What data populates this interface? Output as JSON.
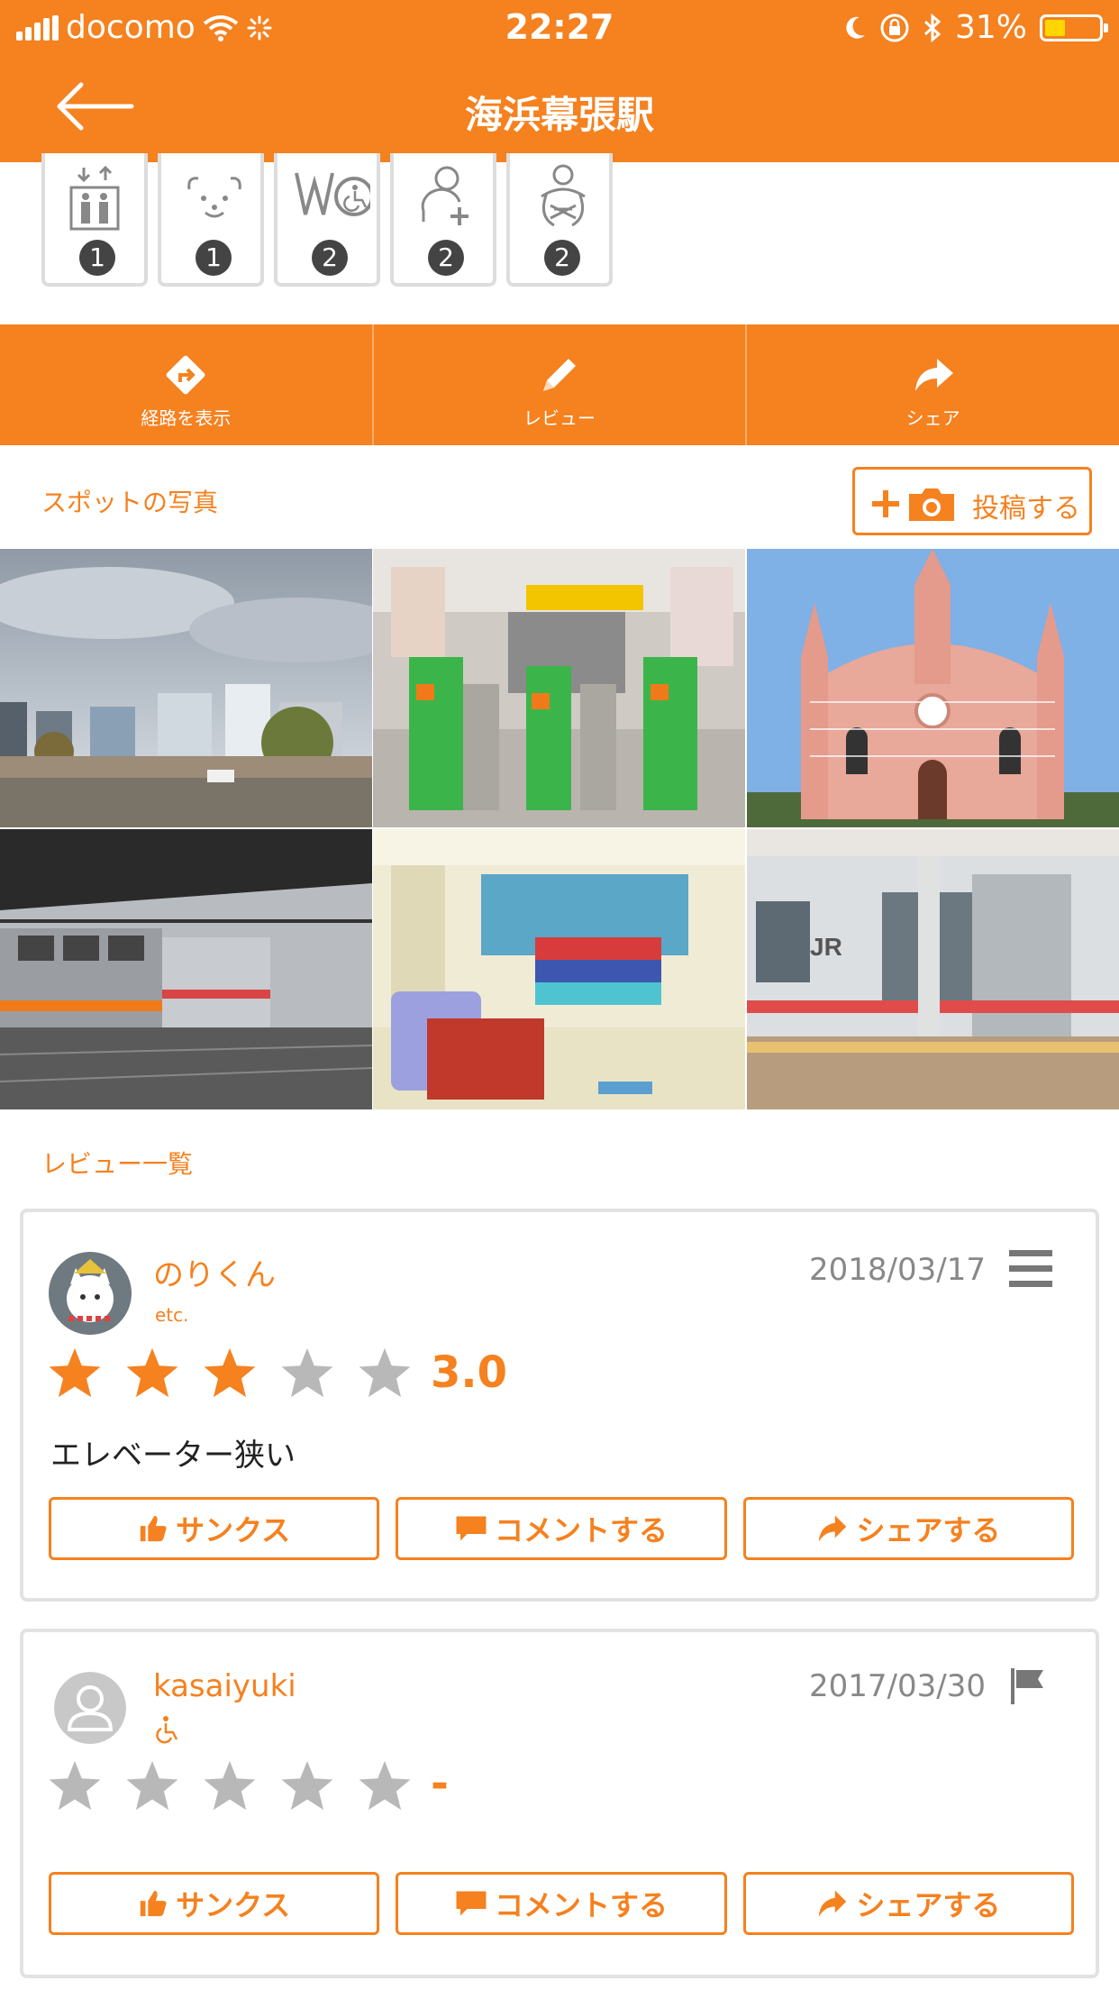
{
  "status": {
    "carrier": "docomo",
    "time": "22:27",
    "battery": "31%"
  },
  "header": {
    "title": "海浜幕張駅"
  },
  "facilities": [
    {
      "icon": "elevator-icon",
      "count": "1"
    },
    {
      "icon": "assistance-dog-icon",
      "count": "1"
    },
    {
      "icon": "accessible-toilet-icon",
      "count": "2"
    },
    {
      "icon": "first-aid-room-icon",
      "count": "2"
    },
    {
      "icon": "baby-room-icon",
      "count": "2"
    }
  ],
  "actions": [
    {
      "label": "経路を表示",
      "icon": "route-icon"
    },
    {
      "label": "レビュー",
      "icon": "pencil-icon"
    },
    {
      "label": "シェア",
      "icon": "share-icon"
    }
  ],
  "photos_section": {
    "label": "スポットの写真",
    "post_button": "投稿する"
  },
  "reviews_section": {
    "label": "レビュー一覧"
  },
  "reviews": [
    {
      "user": "のりくん",
      "tag": "etc.",
      "date": "2018/03/17",
      "rating": 3,
      "rating_text": "3.0",
      "comment": "エレベーター狭い",
      "buttons": {
        "thanks": "サンクス",
        "comment": "コメントする",
        "share": "シェアする"
      }
    },
    {
      "user": "kasaiyuki",
      "tag_icon": "wheelchair-icon",
      "date": "2017/03/30",
      "rating": 0,
      "rating_text": "-",
      "comment": "",
      "buttons": {
        "thanks": "サンクス",
        "comment": "コメントする",
        "share": "シェアする"
      }
    }
  ],
  "colors": {
    "accent": "#f5811f",
    "star_off": "#b8b8b8",
    "border": "#e2e2e2"
  }
}
